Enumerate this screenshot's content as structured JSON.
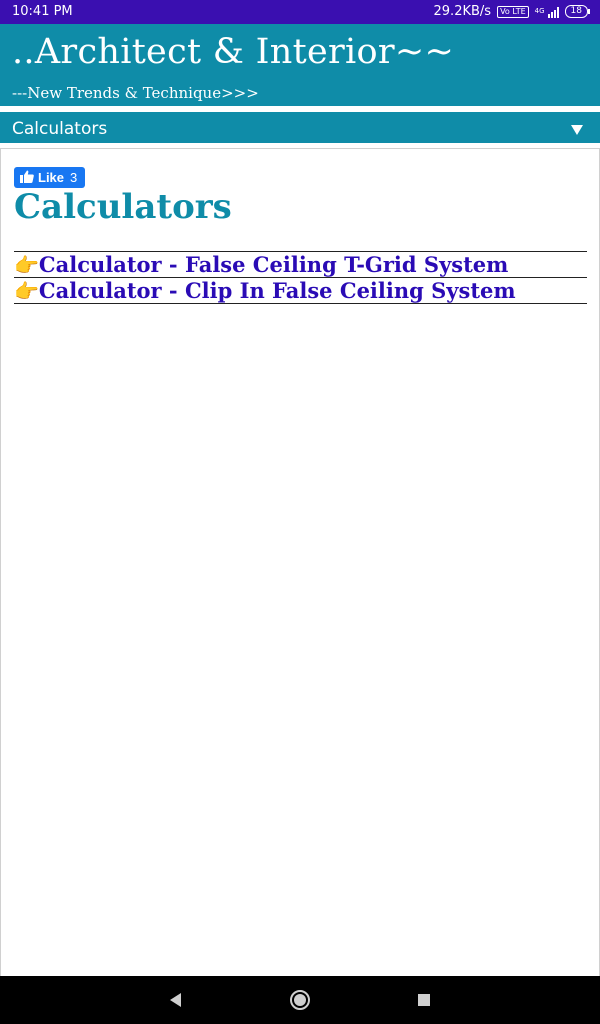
{
  "status_bar": {
    "time": "10:41 PM",
    "network_speed": "29.2KB/s",
    "volte": "Vo LTE",
    "network_type": "4G",
    "battery": "18"
  },
  "site": {
    "title": "..Architect & Interior~~",
    "tagline": "---New Trends & Technique>>>"
  },
  "nav": {
    "label": "Calculators",
    "dropdown_icon": "triangle-down-icon"
  },
  "like_button": {
    "label": "Like",
    "count": "3",
    "icon": "thumbs-up-icon"
  },
  "page": {
    "title": "Calculators"
  },
  "posts": [
    {
      "emoji": "👉",
      "label": "Calculator - False Ceiling T-Grid System"
    },
    {
      "emoji": "👉",
      "label": "Calculator - Clip In False Ceiling System"
    }
  ],
  "system_nav": {
    "back_icon": "back-triangle-icon",
    "home_icon": "home-circle-icon",
    "recent_icon": "recent-square-icon"
  },
  "colors": {
    "status_bar": "#3a0fb0",
    "header": "#0f8ca8",
    "link": "#2a0bb5",
    "facebook": "#1877f2"
  }
}
